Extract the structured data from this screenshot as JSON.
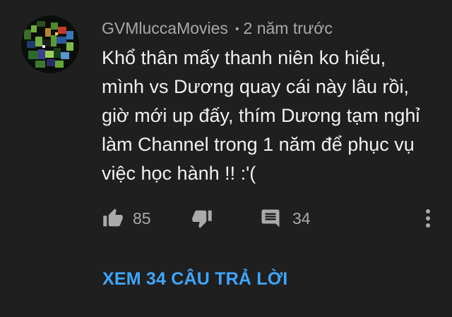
{
  "comment": {
    "author": "GVMluccaMovies",
    "separator": "•",
    "time": "2 năm trước",
    "text_lines": [
      "Khổ thân mấy thanh niên ko hiểu,",
      "mình vs Dương quay cái này lâu rồi,",
      "giờ mới up đấy, thím Dương tạm nghỉ",
      "làm Channel trong 1 năm để phục vụ",
      "việc học hành !! :'("
    ],
    "avatar_icon": "pixel-art-avatar",
    "actions": {
      "like_icon": "thumbs-up-icon",
      "like_count": "85",
      "dislike_icon": "thumbs-down-icon",
      "reply_icon": "comment-icon",
      "reply_count": "34",
      "more_icon": "more-vertical-icon"
    },
    "view_replies_label": "XEM 34 CÂU TRẢ LỜI"
  },
  "colors": {
    "background": "#1f1f1f",
    "text": "#f1f1f1",
    "meta_text": "#a9a9a9",
    "link": "#3ea6ff"
  }
}
